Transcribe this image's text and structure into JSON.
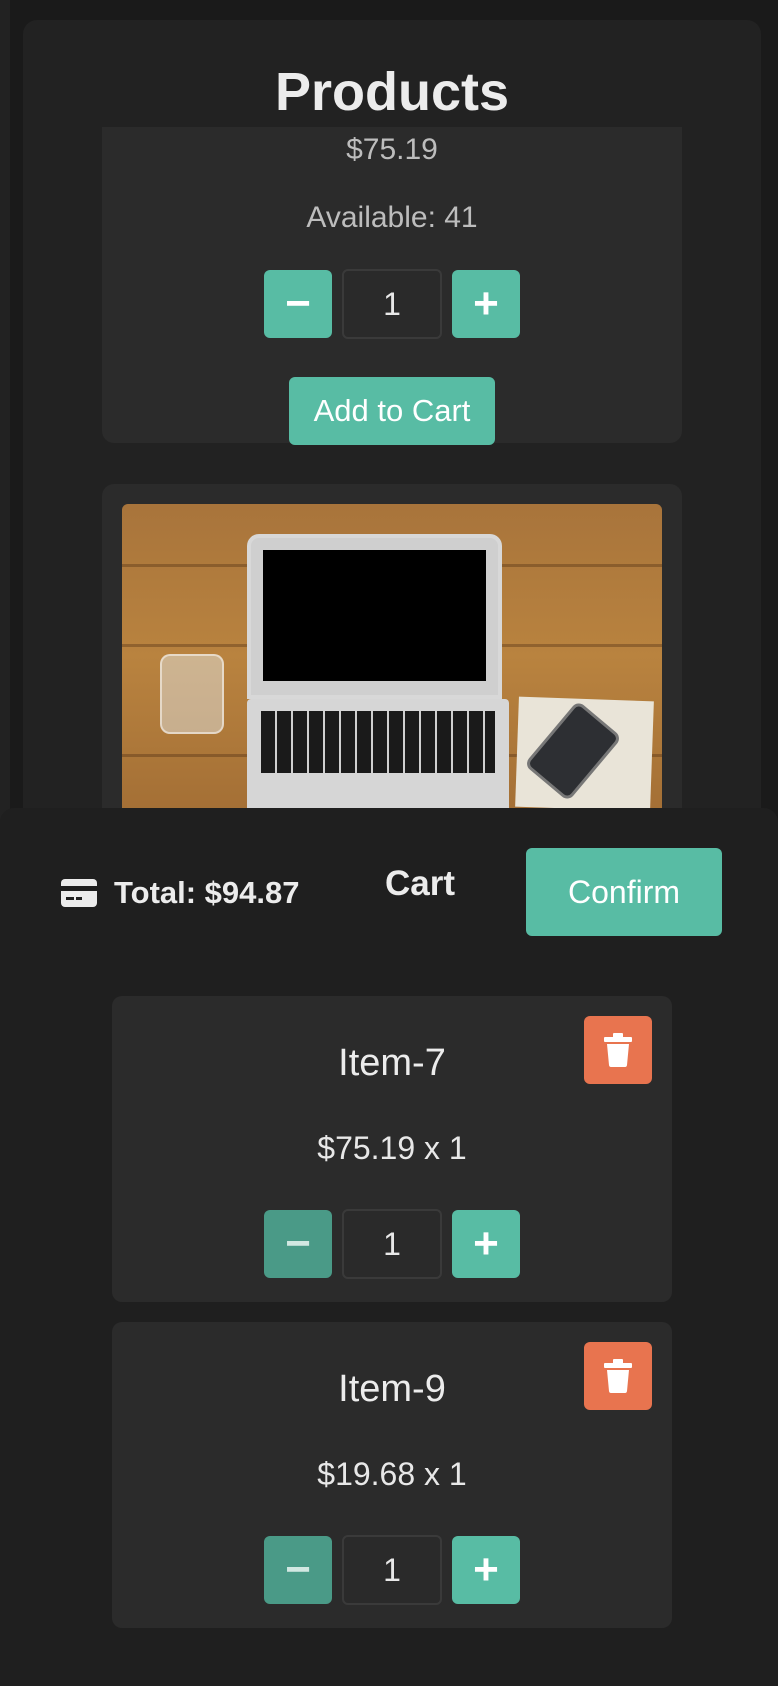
{
  "products": {
    "title": "Products",
    "cards": [
      {
        "price": "$75.19",
        "available": "Available: 41",
        "qty": "1",
        "add_label": "Add to Cart"
      }
    ]
  },
  "cart": {
    "title": "Cart",
    "total_label": "Total: $94.87",
    "confirm_label": "Confirm",
    "items": [
      {
        "name": "Item-7",
        "price_line": "$75.19 x 1",
        "qty": "1"
      },
      {
        "name": "Item-9",
        "price_line": "$19.68 x 1",
        "qty": "1"
      }
    ]
  },
  "glyphs": {
    "minus": "−",
    "plus": "+"
  },
  "icons": [
    "credit-card-icon",
    "trash-icon",
    "minus-icon",
    "plus-icon"
  ],
  "colors": {
    "accent": "#58bca4",
    "danger": "#e8744f",
    "panel": "#2b2b2b",
    "background": "#1a1a1a"
  }
}
